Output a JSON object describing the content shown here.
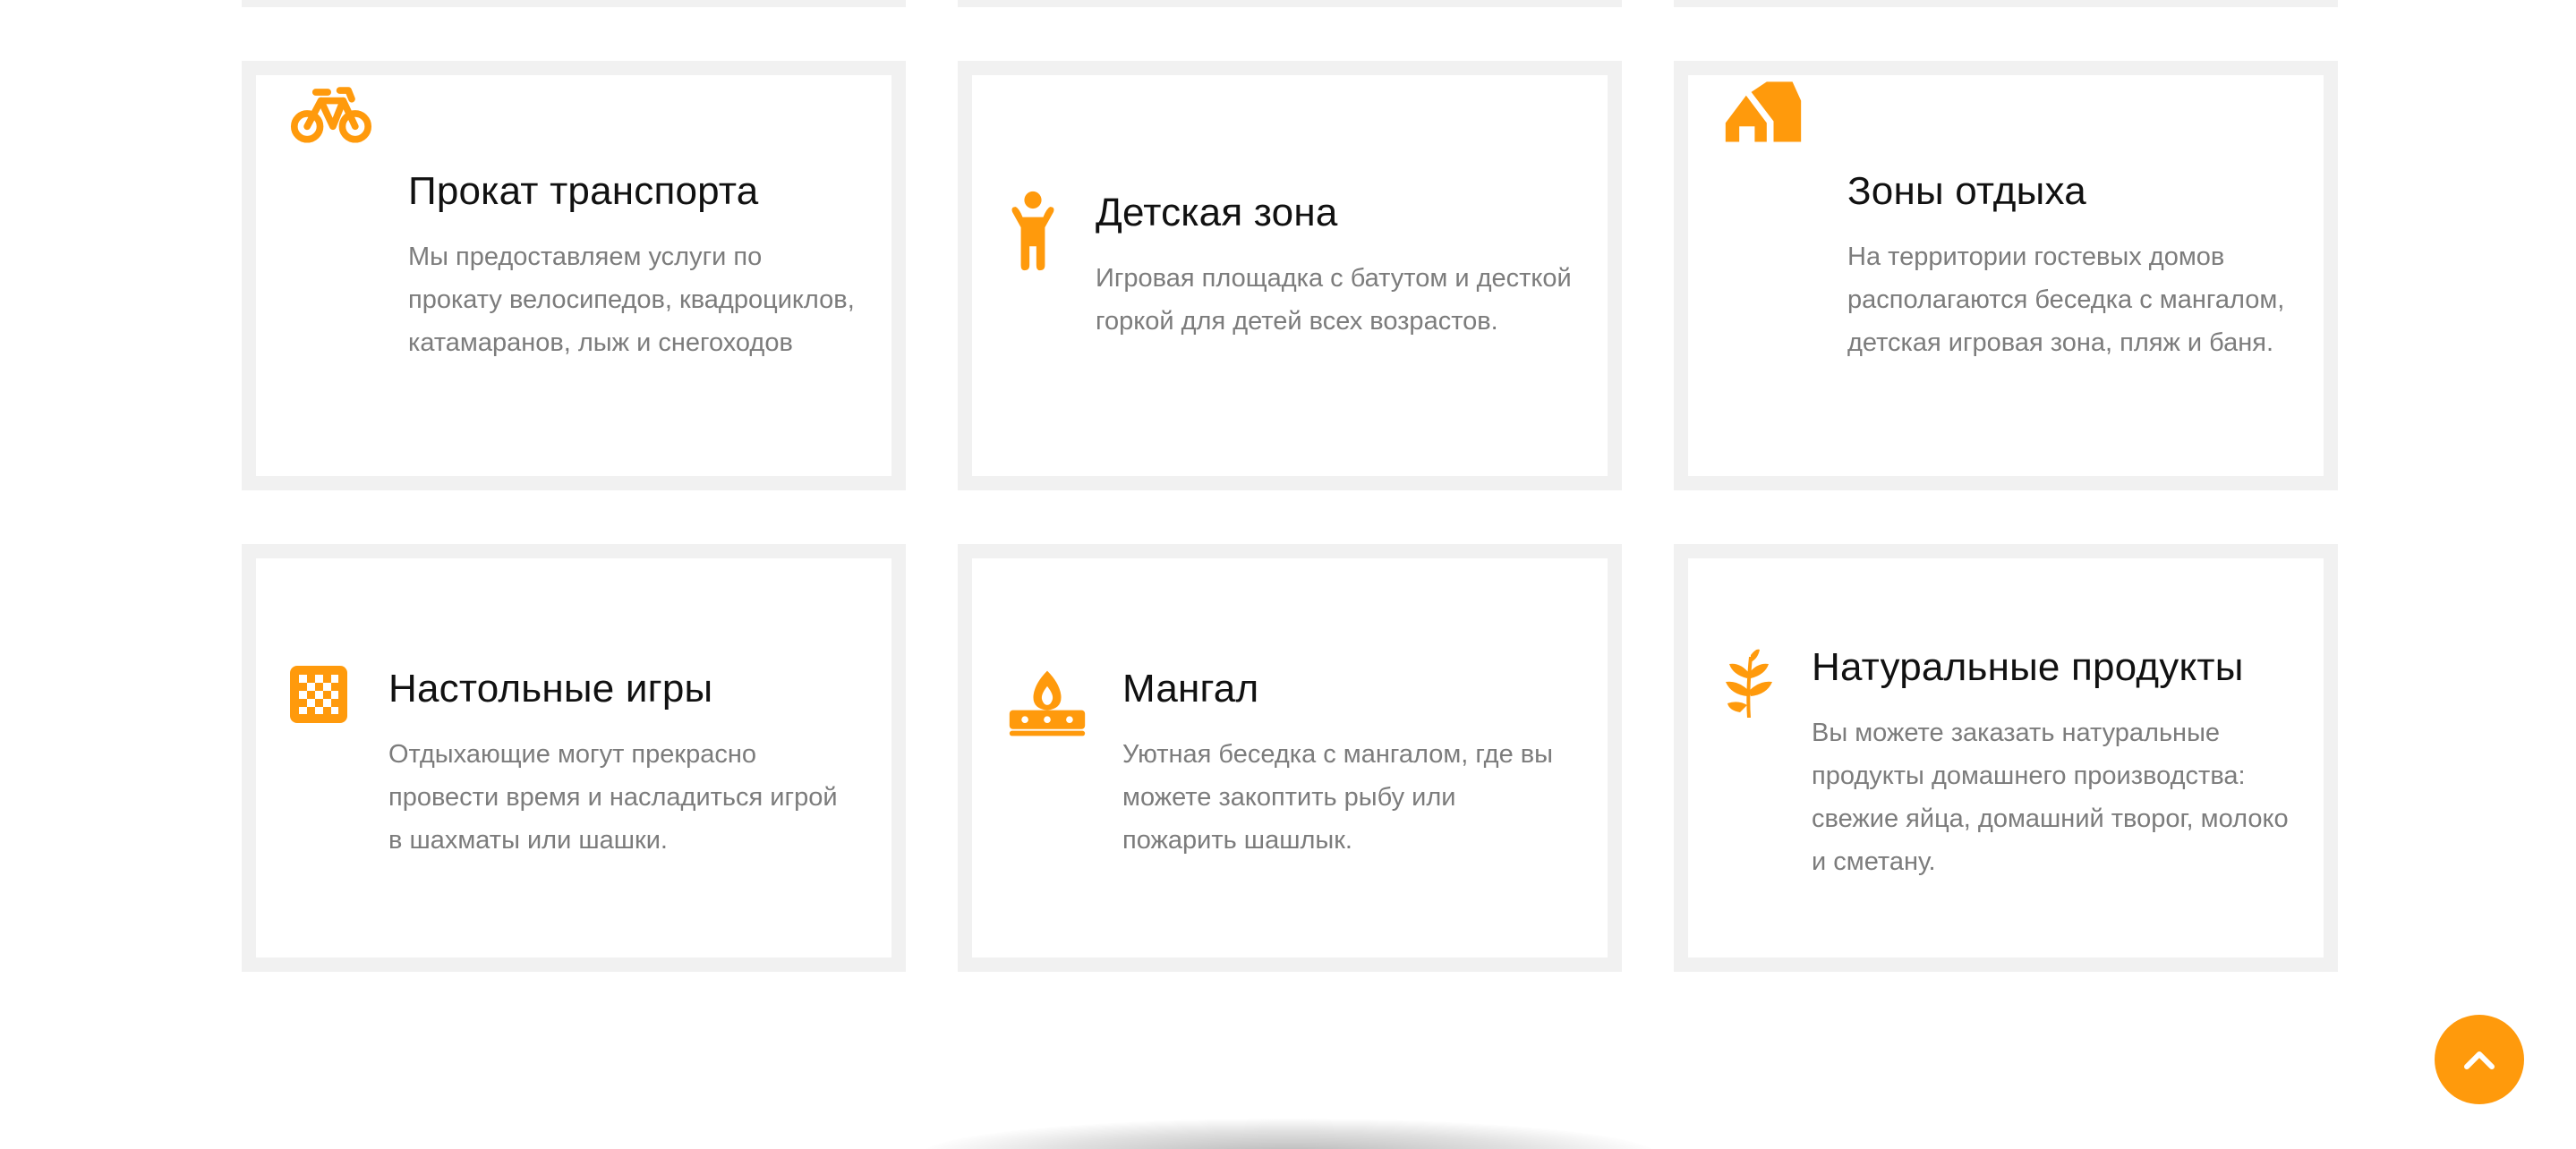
{
  "accent_color": "#ff9a0c",
  "features": [
    {
      "icon": "bicycle-icon",
      "title": "Прокат транспорта",
      "desc": "Мы предоставляем услуги по прокату велосипедов, квадроциклов, катамаранов, лыж и снегоходов"
    },
    {
      "icon": "child-icon",
      "title": "Детская зона",
      "desc": "Игровая площадка с батутом и десткой горкой для детей всех возрастов."
    },
    {
      "icon": "tent-icon",
      "title": "Зоны отдыха",
      "desc": "На территории гостевых домов располагаются беседка с мангалом, детская игровая зона, пляж и баня."
    },
    {
      "icon": "chessboard-icon",
      "title": "Настольные игры",
      "desc": "Отдыхающие могут прекрасно провести время и насладиться игрой в шахматы или шашки."
    },
    {
      "icon": "grill-fire-icon",
      "title": "Мангал",
      "desc": "Уютная беседка с мангалом, где вы можете закоптить рыбу или пожарить шашлык."
    },
    {
      "icon": "wheat-icon",
      "title": "Натуральные продукты",
      "desc": "Вы можете заказать натуральные продукты домашнего производства: свежие яйца, домашний творог, молоко и сметану."
    }
  ],
  "scroll_top": {
    "icon": "chevron-up-icon"
  }
}
